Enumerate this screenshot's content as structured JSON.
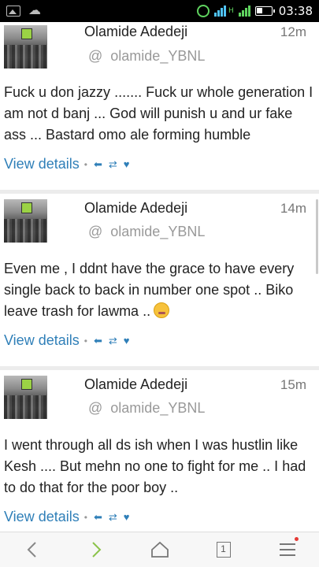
{
  "status_bar": {
    "time": "03:38",
    "network_label": "H"
  },
  "tweets": [
    {
      "name": "Olamide Adedeji",
      "handle": "olamide_YBNL",
      "at": "@",
      "time_ago": "12m",
      "text": "Fuck u don jazzy ....... Fuck ur whole generation I am not d banj ... God will punish u and ur fake ass ... Bastard omo ale forming humble",
      "view_details": "View details"
    },
    {
      "name": "Olamide Adedeji",
      "handle": "olamide_YBNL",
      "at": "@",
      "time_ago": "14m",
      "text": "Even me , I ddnt have the grace to have every single back to back in number one spot .. Biko leave trash for lawma ..",
      "view_details": "View details"
    },
    {
      "name": "Olamide Adedeji",
      "handle": "olamide_YBNL",
      "at": "@",
      "time_ago": "15m",
      "text": "I went through all ds ish when I was hustlin like Kesh .... But mehn no one to fight for me .. I had to do that for the poor boy ..",
      "view_details": "View details"
    }
  ],
  "action_icons": [
    "reply-icon",
    "retweet-icon",
    "favorite-icon"
  ],
  "bottom_nav": {
    "tab_count": "1",
    "items": [
      "back-icon",
      "forward-icon",
      "home-icon",
      "tabs-icon",
      "menu-icon"
    ]
  },
  "colors": {
    "link": "#2f7fb8",
    "forward_arrow": "#8bc34a",
    "notification_dot": "#e53935"
  }
}
